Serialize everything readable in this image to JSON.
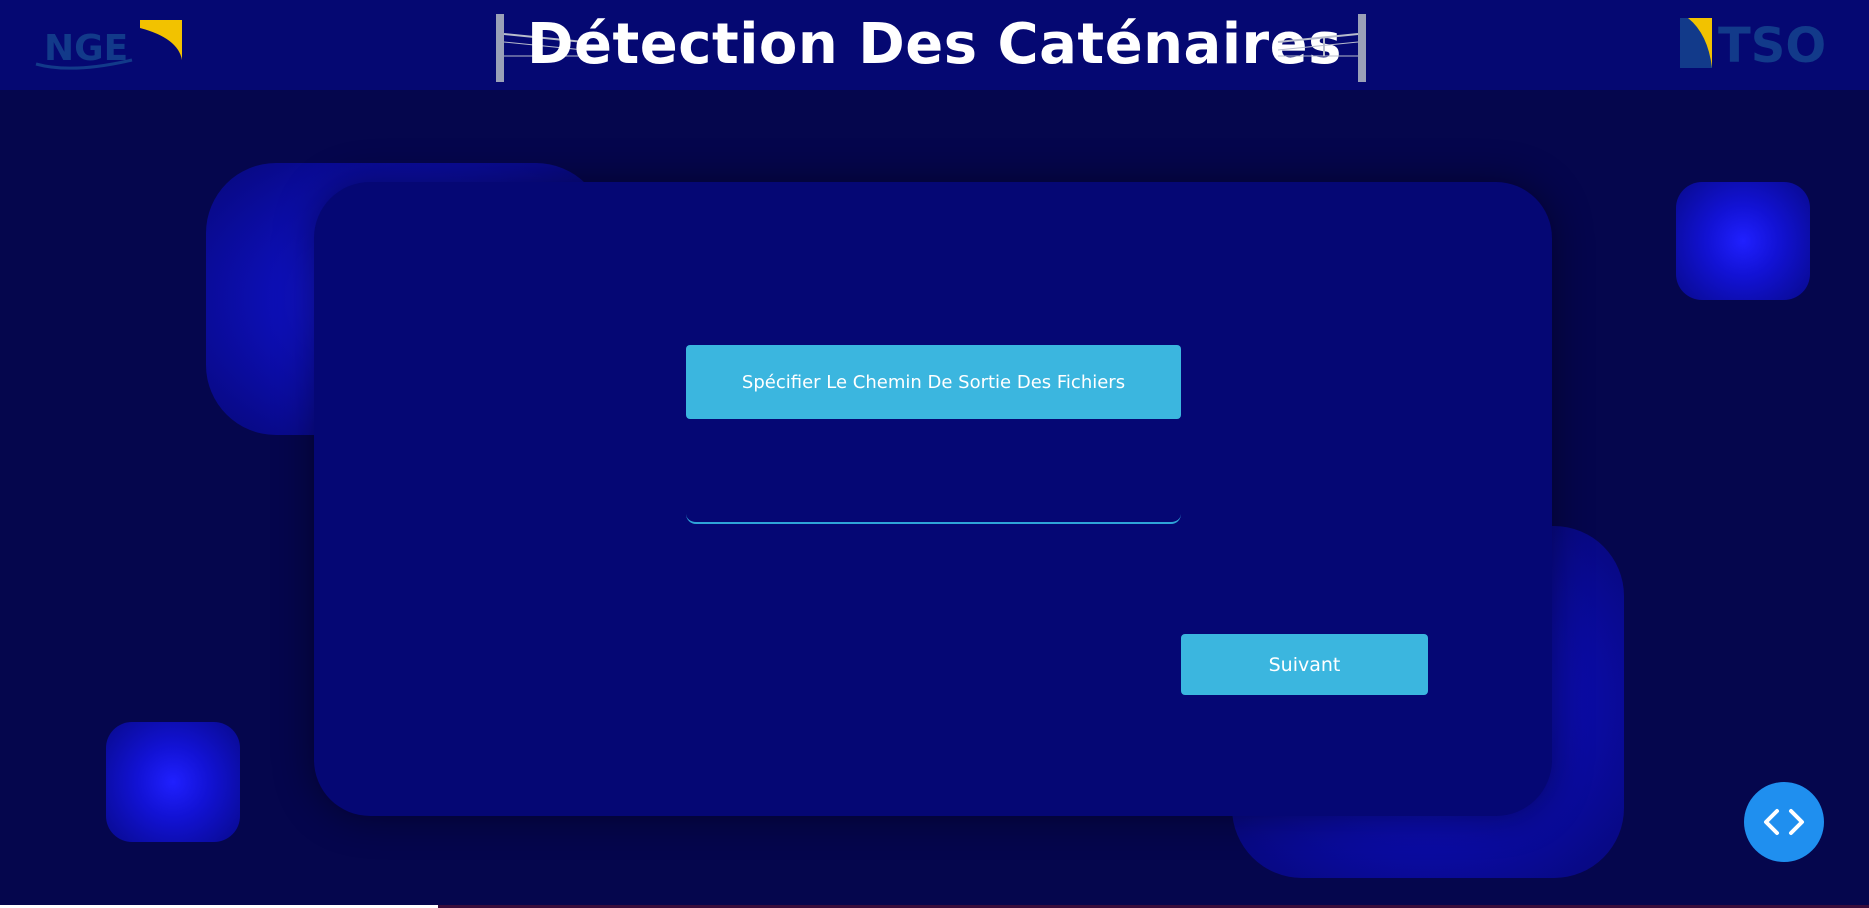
{
  "header": {
    "title": "Détection Des Caténaires",
    "logo_left": "NGE",
    "logo_right": "TSO"
  },
  "form": {
    "output_path_button_label": "Spécifier Le Chemin De Sortie Des Fichiers",
    "output_path_value": "",
    "next_button_label": "Suivant"
  },
  "fab": {
    "icon": "code-icon"
  },
  "colors": {
    "background": "#05064d",
    "header": "#050872",
    "card": "#050774",
    "button": "#3bb6df",
    "fab": "#1f8fef",
    "logo_accent": "#f2c200",
    "logo_dark": "#123a8a"
  }
}
